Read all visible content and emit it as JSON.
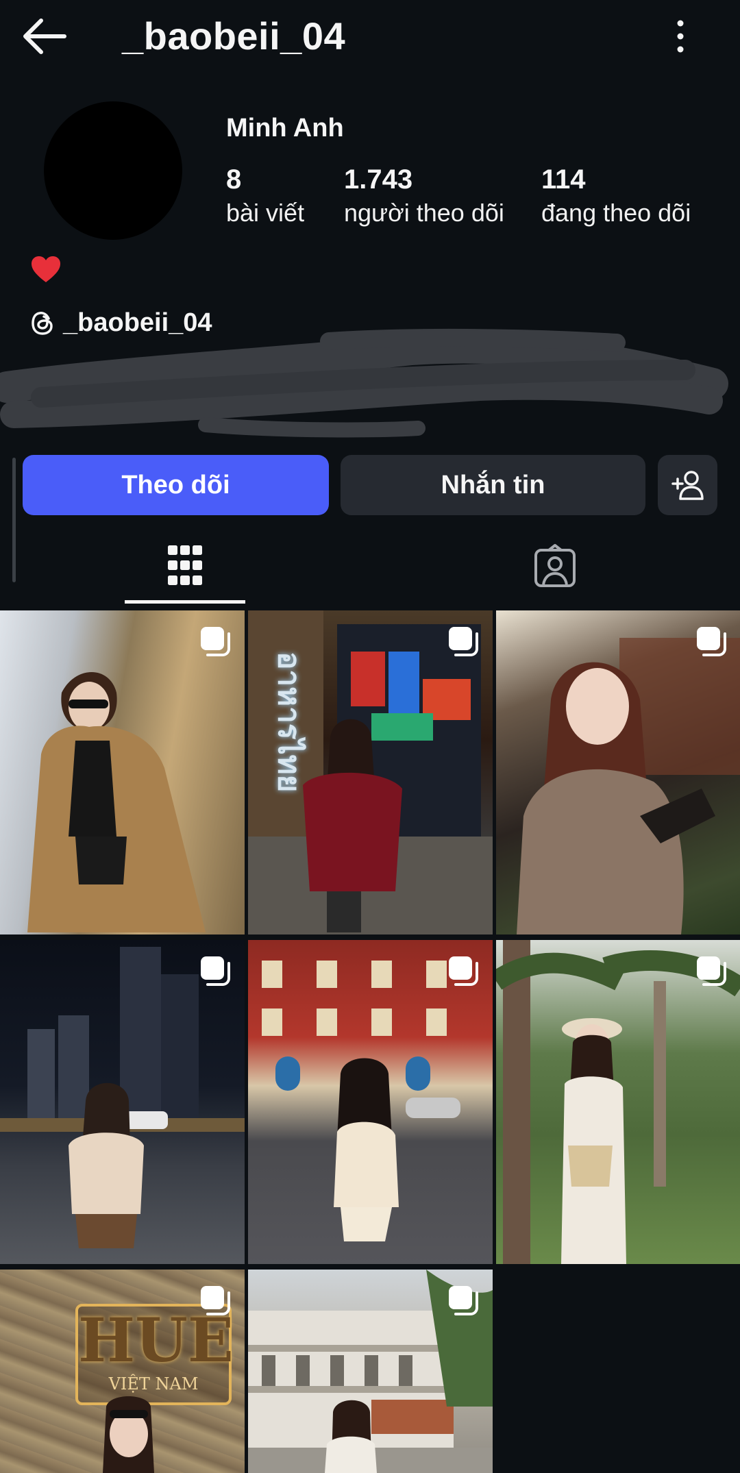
{
  "header": {
    "username": "_baobeii_04",
    "back_icon": "arrow-left-icon",
    "more_icon": "more-vertical-icon"
  },
  "profile": {
    "display_name": "Minh Anh",
    "stats": [
      {
        "value": "8",
        "label": "bài viết"
      },
      {
        "value": "1.743",
        "label": "người theo dõi"
      },
      {
        "value": "114",
        "label": "đang theo dõi"
      }
    ],
    "bio_emoji": "❤️",
    "threads_handle": "_baobeii_04"
  },
  "actions": {
    "follow_label": "Theo dõi",
    "message_label": "Nhắn tin",
    "suggest_icon": "add-person-icon"
  },
  "tabs": [
    {
      "icon": "grid-icon",
      "active": true
    },
    {
      "icon": "tagged-person-icon",
      "active": false
    }
  ],
  "posts": [
    {
      "id": 1,
      "scene": "woman in sunglasses and camel coat by a wall",
      "multi": true
    },
    {
      "id": 2,
      "scene": "woman in burgundy sweater outside a Thai restaurant",
      "sign": "อาหารไทย",
      "multi": true
    },
    {
      "id": 3,
      "scene": "selfie in fur coat at night",
      "multi": true
    },
    {
      "id": 4,
      "scene": "woman on a city street at night with skyscrapers",
      "multi": true
    },
    {
      "id": 5,
      "scene": "woman in white outfit in front of red building",
      "multi": true
    },
    {
      "id": 6,
      "scene": "woman in hat among palm trees",
      "multi": true
    },
    {
      "id": 7,
      "scene": "woman in front of stone wall with sign",
      "sign": "HUE",
      "sign_sub": "VIỆT NAM",
      "multi": true
    },
    {
      "id": 8,
      "scene": "woman in front of colonial building",
      "multi": true
    }
  ],
  "colors": {
    "background": "#0c1014",
    "primary_button": "#4a5df9",
    "secondary_button": "#262a31"
  }
}
